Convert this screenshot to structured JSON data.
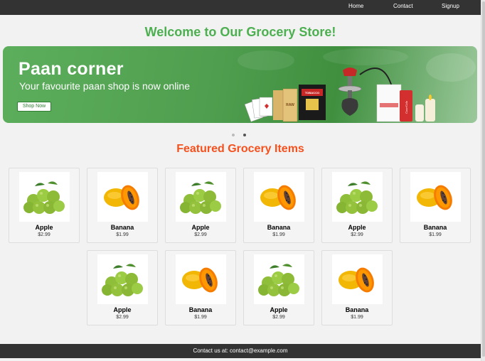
{
  "nav": {
    "home": "Home",
    "contact": "Contact",
    "signup": "Signup"
  },
  "welcome": "Welcome to Our Grocery Store!",
  "banner": {
    "title": "Paan corner",
    "subtitle": "Your favourite paan shop is now online",
    "button": "Shop Now",
    "art_labels": [
      "RAW",
      "TOBACCO",
      "Coca-Cola"
    ]
  },
  "carousel": {
    "slides": 2,
    "active_index": 1
  },
  "featured_title": "Featured Grocery Items",
  "products": [
    {
      "name": "Apple",
      "price": "$2.99",
      "icon": "apple-icon"
    },
    {
      "name": "Banana",
      "price": "$1.99",
      "icon": "papaya-icon"
    },
    {
      "name": "Apple",
      "price": "$2.99",
      "icon": "apple-icon"
    },
    {
      "name": "Banana",
      "price": "$1.99",
      "icon": "papaya-icon"
    },
    {
      "name": "Apple",
      "price": "$2.99",
      "icon": "apple-icon"
    },
    {
      "name": "Banana",
      "price": "$1.99",
      "icon": "papaya-icon"
    },
    {
      "name": "Apple",
      "price": "$2.99",
      "icon": "apple-icon"
    },
    {
      "name": "Banana",
      "price": "$1.99",
      "icon": "papaya-icon"
    },
    {
      "name": "Apple",
      "price": "$2.99",
      "icon": "apple-icon"
    },
    {
      "name": "Banana",
      "price": "$1.99",
      "icon": "papaya-icon"
    }
  ],
  "footer": "Contact us at: contact@example.com",
  "colors": {
    "accent_green": "#4caf50",
    "accent_orange": "#f4511e",
    "nav_bg": "#333333"
  }
}
